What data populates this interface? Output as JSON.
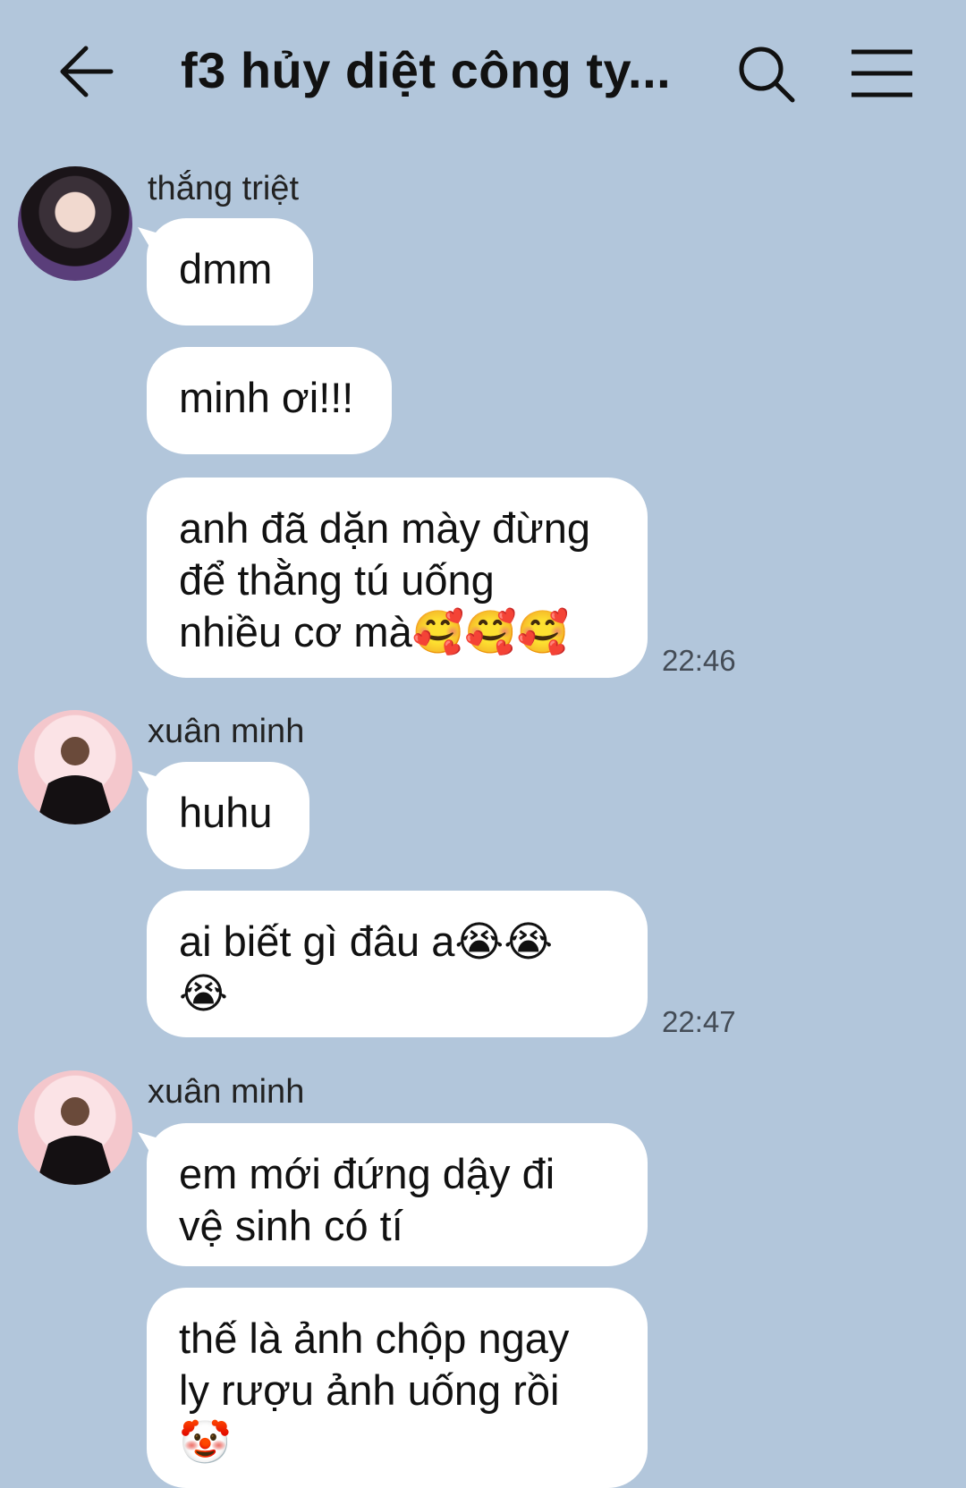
{
  "header": {
    "title": "f3 hủy diệt công ty...",
    "back_icon": "arrow-left-icon",
    "search_icon": "search-icon",
    "menu_icon": "hamburger-menu-icon"
  },
  "messages": [
    {
      "sender": "thắng triệt",
      "bubbles": [
        "dmm",
        "minh ơi!!!",
        "anh đã dặn mày đừng\nđể thằng tú uống\nnhiều cơ mà🥰🥰🥰"
      ],
      "time": "22:46"
    },
    {
      "sender": "xuân minh",
      "bubbles": [
        "huhu",
        "ai biết gì đâu a😭😭\n😭"
      ],
      "time": "22:47"
    },
    {
      "sender": "xuân minh",
      "bubbles": [
        "em mới đứng dậy đi\nvệ sinh có tí",
        "thế là ảnh chộp ngay\nly rượu ảnh uống rồi\n🤡"
      ]
    }
  ],
  "colors": {
    "background": "#b2c6db",
    "bubble": "#ffffff"
  }
}
